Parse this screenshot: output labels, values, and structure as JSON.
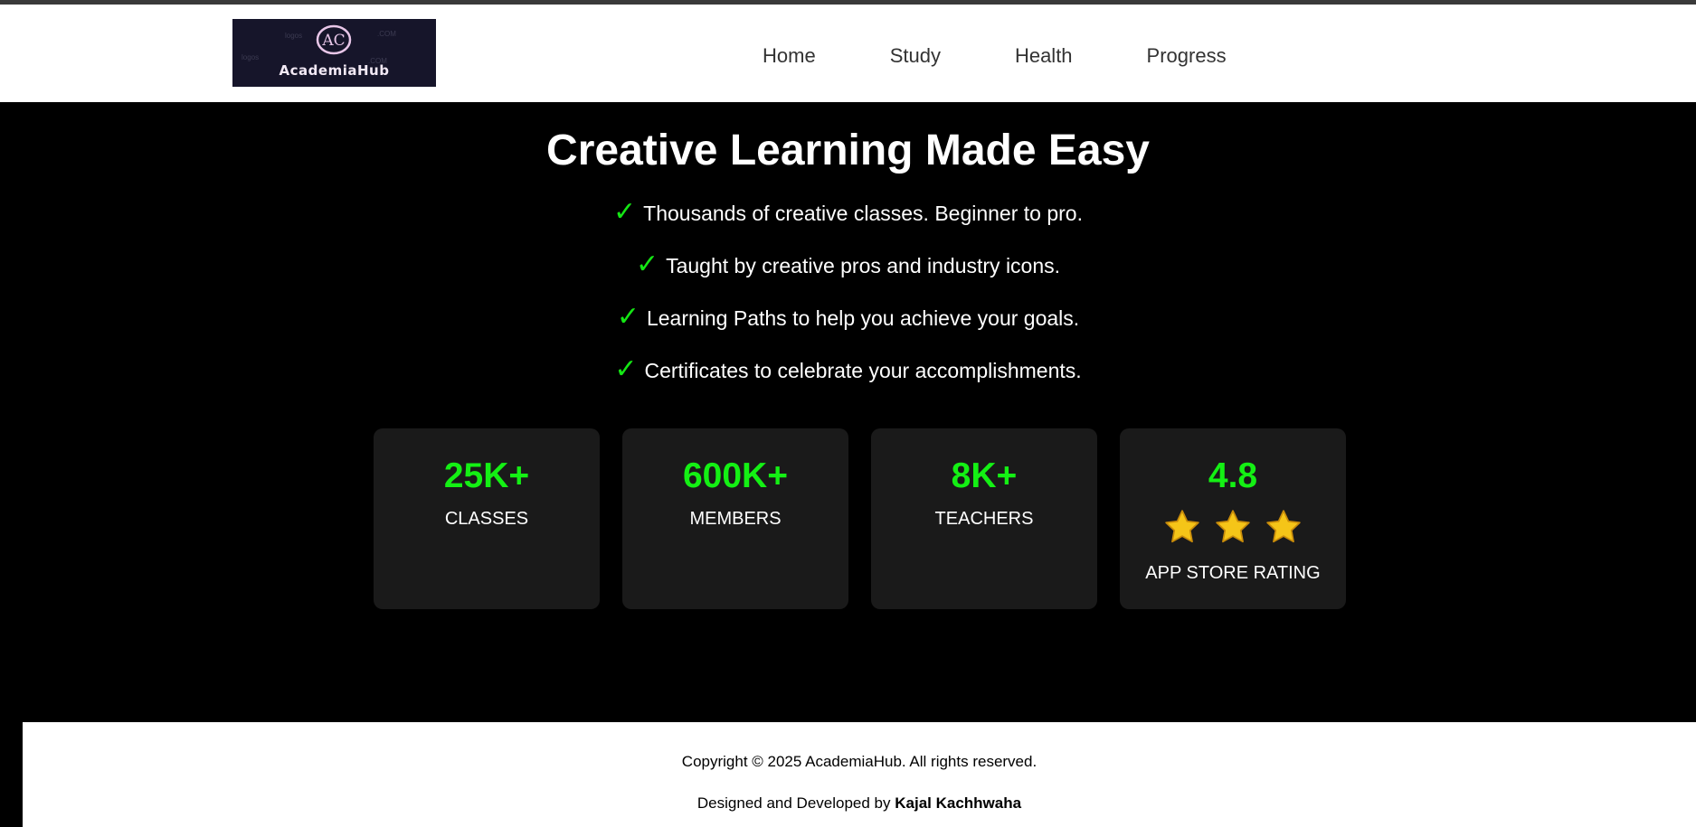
{
  "header": {
    "logo_text": "AcademiaHub",
    "logo_monogram": "AC",
    "logo_watermarks": [
      "logos",
      ".COM"
    ],
    "nav": [
      {
        "label": "Home"
      },
      {
        "label": "Study"
      },
      {
        "label": "Health"
      },
      {
        "label": "Progress"
      }
    ]
  },
  "hero": {
    "title": "Creative Learning Made Easy",
    "check_glyph": "✓",
    "features": [
      "Thousands of creative classes. Beginner to pro.",
      "Taught by creative pros and industry icons.",
      "Learning Paths to help you achieve your goals.",
      "Certificates to celebrate your accomplishments."
    ]
  },
  "stats": [
    {
      "value": "25K+",
      "label": "CLASSES"
    },
    {
      "value": "600K+",
      "label": "MEMBERS"
    },
    {
      "value": "8K+",
      "label": "TEACHERS"
    },
    {
      "value": "4.8",
      "label": "APP STORE RATING",
      "stars_shown": 3
    }
  ],
  "footer": {
    "copyright": "Copyright © 2025 AcademiaHub. All rights reserved.",
    "credit_prefix": "Designed and Developed by",
    "credit_name": "Kajal Kachhwaha"
  },
  "colors": {
    "accent_green": "#14f014",
    "card_bg": "#1a1a1a",
    "star": "#f5c518"
  }
}
